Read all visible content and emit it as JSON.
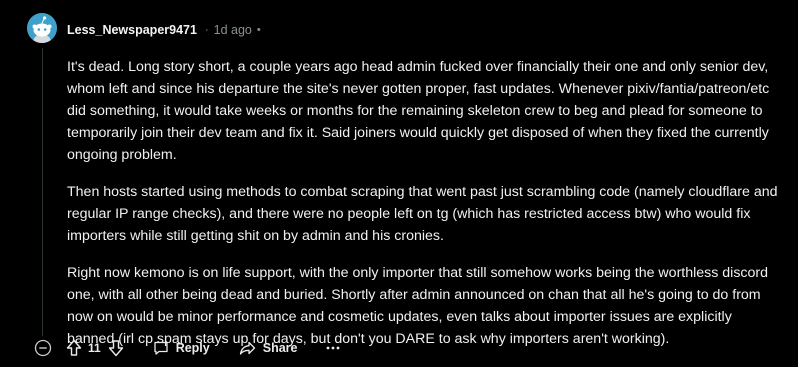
{
  "comment": {
    "username": "Less_Newspaper9471",
    "separator": "·",
    "time": "1d ago",
    "edited_marker": "•",
    "paragraphs": [
      "It's dead. Long story short, a couple years ago head admin fucked over financially their one and only senior dev, whom left and since his departure the site's never gotten proper, fast updates. Whenever pixiv/fantia/patreon/etc did something, it would take weeks or months for the remaining skeleton crew to beg and plead for someone to temporarily join their dev team and fix it. Said joiners would quickly get disposed of when they fixed the currently ongoing problem.",
      "Then hosts started using methods to combat scraping that went past just scrambling code (namely cloudflare and regular IP range checks), and there were no people left on tg (which has restricted access btw) who would fix importers while still getting shit on by admin and his cronies.",
      "Right now kemono is on life support, with the only importer that still somehow works being the worthless discord one, with all other being dead and buried. Shortly after admin announced on chan that all he's going to do from now on would be minor performance and cosmetic updates, even talks about importer issues are explicitly banned (irl cp spam stays up for days, but don't you DARE to ask why importers aren't working)."
    ]
  },
  "actions": {
    "collapse_icon": "collapse-minus-icon",
    "upvote_icon": "upvote-arrow-icon",
    "vote_count": "11",
    "downvote_icon": "downvote-arrow-icon",
    "reply_label": "Reply",
    "reply_icon": "speech-bubble-icon",
    "share_label": "Share",
    "share_icon": "share-arrow-icon",
    "more_label": "···",
    "more_icon": "ellipsis-icon"
  },
  "colors": {
    "background": "#000000",
    "text": "#f1f1f1",
    "meta": "#8a9194",
    "avatar": "#3fa0c9"
  }
}
